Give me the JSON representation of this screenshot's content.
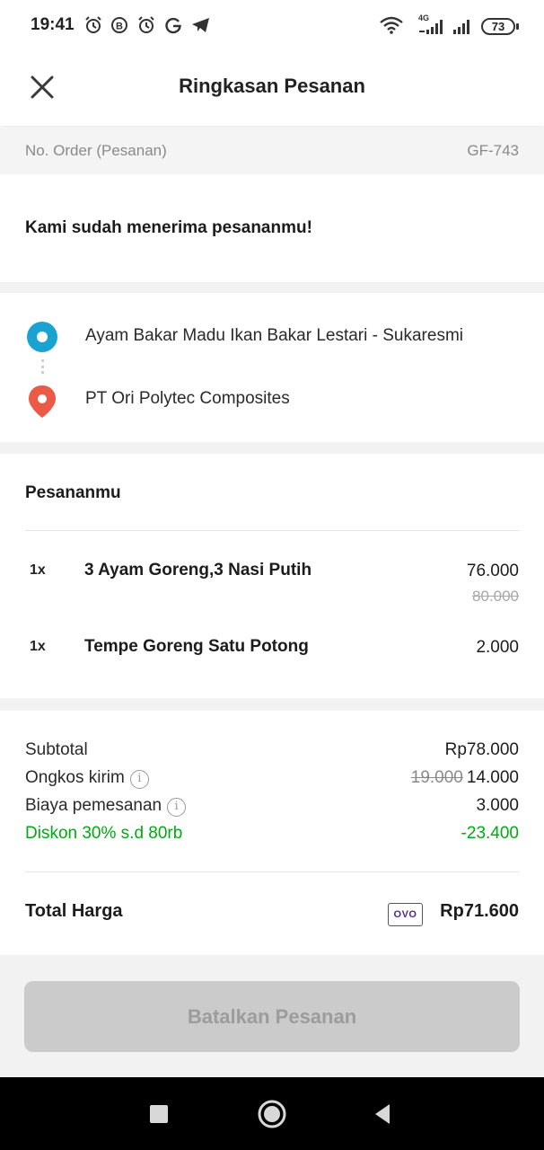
{
  "status_bar": {
    "time": "19:41",
    "network_label": "4G",
    "battery": "73",
    "icons": [
      "alarm-icon",
      "b-icon",
      "alarm-icon",
      "google-icon",
      "telegram-icon",
      "wifi-icon",
      "signal-icon"
    ]
  },
  "header": {
    "title": "Ringkasan Pesanan",
    "close_icon": "close-icon"
  },
  "order": {
    "label": "No. Order (Pesanan)",
    "number": "GF-743"
  },
  "status_message": "Kami sudah menerima pesananmu!",
  "route": {
    "pickup": "Ayam Bakar Madu Ikan Bakar Lestari - Sukaresmi",
    "destination": "PT Ori Polytec Composites"
  },
  "items_section": {
    "title": "Pesananmu",
    "items": [
      {
        "qty": "1x",
        "name": "3 Ayam Goreng,3 Nasi Putih",
        "price": "76.000",
        "old_price": "80.000"
      },
      {
        "qty": "1x",
        "name": "Tempe Goreng Satu Potong",
        "price": "2.000",
        "old_price": ""
      }
    ]
  },
  "summary": {
    "subtotal_label": "Subtotal",
    "subtotal_value": "Rp78.000",
    "delivery_label": "Ongkos kirim",
    "delivery_old": "19.000",
    "delivery_value": "14.000",
    "fee_label": "Biaya pemesanan",
    "fee_value": "3.000",
    "discount_label": "Diskon 30% s.d 80rb",
    "discount_value": "-23.400",
    "total_label": "Total Harga",
    "payment_method": "OVO",
    "total_value": "Rp71.600"
  },
  "actions": {
    "cancel_label": "Batalkan Pesanan"
  },
  "colors": {
    "accent_green": "#00aa13",
    "pickup_blue": "#1aa3d1",
    "dest_red": "#ea5a47",
    "disabled_button": "#cbcbcb"
  }
}
